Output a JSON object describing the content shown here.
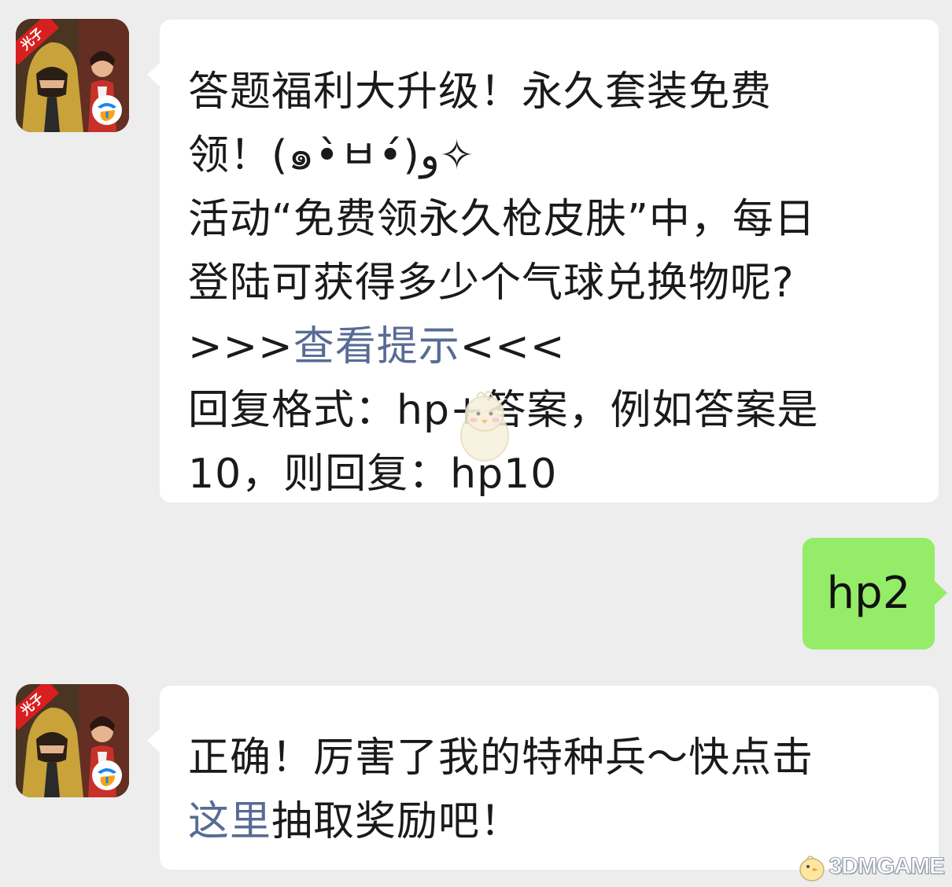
{
  "avatar": {
    "badge": "光子",
    "logo_icon": "tencent-games-logo-icon"
  },
  "message_1": {
    "lines": [
      "答题福利大升级！永久套装免费",
      "领！(๑•̀ㅂ•́)و✧",
      "活动“免费领永久枪皮肤”中，每日",
      "登陆可获得多少个气球兑换物呢?"
    ],
    "hint_prefix": ">>>",
    "hint_link": "查看提示",
    "hint_suffix": "<<<",
    "format_lines": [
      "回复格式：hp+答案，例如答案是",
      "10，则回复：hp10"
    ]
  },
  "message_2": {
    "text": "hp2"
  },
  "message_3": {
    "line1": "正确！厉害了我的特种兵～快点击",
    "link": "这里",
    "line2_rest": "抽取奖励吧！"
  },
  "watermark": {
    "text": "3DMGAME",
    "icon": "chick-mascot-icon"
  },
  "colors": {
    "background": "#ededed",
    "incoming_bubble": "#ffffff",
    "outgoing_bubble": "#95ec69",
    "link": "#576b95"
  }
}
